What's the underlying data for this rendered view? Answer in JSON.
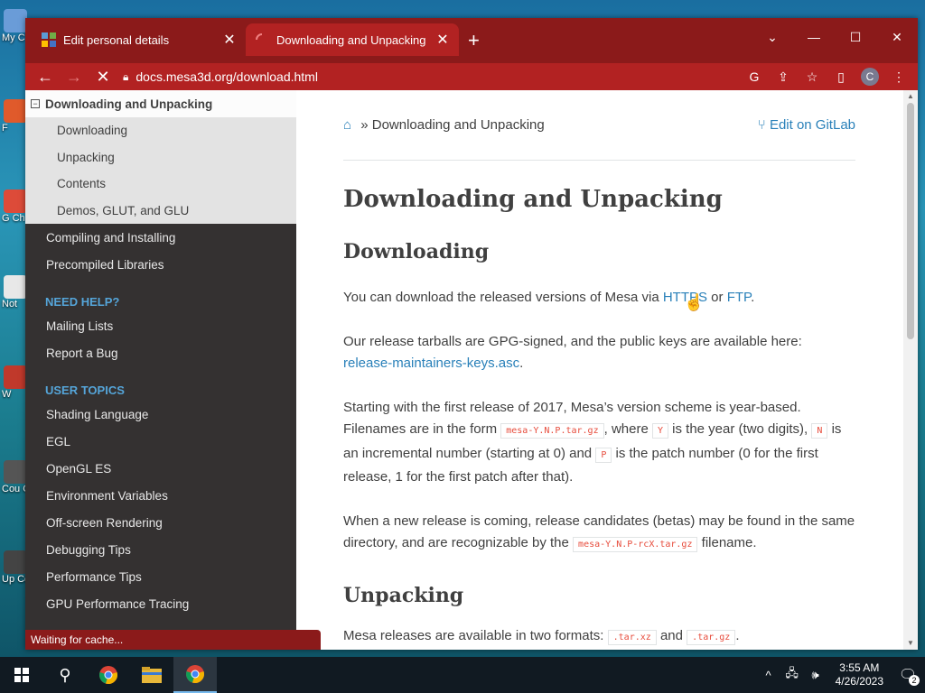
{
  "desktop": {
    "icons": [
      {
        "label": "My C",
        "color": "#6a9cd8"
      },
      {
        "label": "F",
        "color": "#e05a2b"
      },
      {
        "label": "G Ch",
        "color": "#dd4b39"
      },
      {
        "label": "Not",
        "color": "#e8e8e8"
      },
      {
        "label": "W",
        "color": "#c0392b"
      },
      {
        "label": "Cou Glob",
        "color": "#555555"
      },
      {
        "label": "Up Cou",
        "color": "#444444"
      }
    ]
  },
  "browser": {
    "tabs": [
      {
        "title": "Edit personal details",
        "close": "✕"
      },
      {
        "title": "Downloading and Unpacking —",
        "close": "✕"
      }
    ],
    "new_tab": "+",
    "url": "docs.mesa3d.org/download.html",
    "accent": "#b22222",
    "status": "Waiting for cache...",
    "avatar_letter": "C"
  },
  "sidebar": {
    "current": "Downloading and Unpacking",
    "current_toggle": "−",
    "subitems": [
      "Downloading",
      "Unpacking",
      "Contents",
      "Demos, GLUT, and GLU"
    ],
    "items_top": [
      "Compiling and Installing",
      "Precompiled Libraries"
    ],
    "caption_help": "NEED HELP?",
    "items_help": [
      "Mailing Lists",
      "Report a Bug"
    ],
    "caption_topics": "USER TOPICS",
    "items_topics": [
      "Shading Language",
      "EGL",
      "OpenGL ES",
      "Environment Variables",
      "Off-screen Rendering",
      "Debugging Tips",
      "Performance Tips",
      "GPU Performance Tracing"
    ]
  },
  "page": {
    "breadcrumb_sep": "»",
    "breadcrumb_current": "Downloading and Unpacking",
    "edit_link": "Edit on GitLab",
    "title": "Downloading and Unpacking",
    "h_downloading": "Downloading",
    "p1_before": "You can download the released versions of Mesa via ",
    "p1_link1": "HTTPS",
    "p1_mid": " or ",
    "p1_link2": "FTP",
    "p1_after": ".",
    "p2_text": "Our release tarballs are GPG-signed, and the public keys are available here:",
    "p2_link": "release-maintainers-keys.asc",
    "p2_after": ".",
    "p3_a": "Starting with the first release of 2017, Mesa’s version scheme is year-based. Filenames are in the form ",
    "p3_code1": "mesa-Y.N.P.tar.gz",
    "p3_b": ", where ",
    "p3_code2": "Y",
    "p3_c": " is the year (two digits), ",
    "p3_code3": "N",
    "p3_d": " is an incremental number (starting at 0) and ",
    "p3_code4": "P",
    "p3_e": " is the patch number (0 for the first release, 1 for the first patch after that).",
    "p4_a": "When a new release is coming, release candidates (betas) may be found in the same directory, and are recognizable by the ",
    "p4_code": "mesa-Y.N.P-rcX.tar.gz",
    "p4_b": " filename.",
    "h_unpacking": "Unpacking",
    "p5_a": "Mesa releases are available in two formats: ",
    "p5_code1": ".tar.xz",
    "p5_b": " and ",
    "p5_code2": ".tar.gz",
    "p5_c": "."
  },
  "taskbar": {
    "time": "3:55 AM",
    "date": "4/26/2023",
    "notifications": "2"
  }
}
